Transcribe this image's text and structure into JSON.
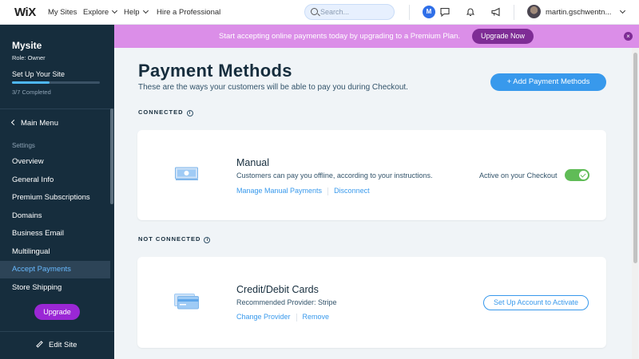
{
  "topbar": {
    "logo": "WiX",
    "nav": [
      "My Sites",
      "Explore",
      "Help",
      "Hire a Professional"
    ],
    "search_placeholder": "Search...",
    "avatar_letter": "M",
    "user_name": "martin.gschwentn..."
  },
  "sidebar": {
    "site_name": "Mysite",
    "role": "Role: Owner",
    "setup_title": "Set Up Your Site",
    "setup_progress": 0.43,
    "setup_completed": "3/7 Completed",
    "main_menu": "Main Menu",
    "settings_label": "Settings",
    "items": [
      {
        "label": "Overview",
        "active": false
      },
      {
        "label": "General Info",
        "active": false
      },
      {
        "label": "Premium Subscriptions",
        "active": false
      },
      {
        "label": "Domains",
        "active": false
      },
      {
        "label": "Business Email",
        "active": false
      },
      {
        "label": "Multilingual",
        "active": false
      },
      {
        "label": "Accept Payments",
        "active": true
      },
      {
        "label": "Store Shipping",
        "active": false
      }
    ],
    "upgrade_label": "Upgrade",
    "edit_site_label": "Edit Site"
  },
  "banner": {
    "text": "Start accepting online payments today by upgrading to a Premium Plan.",
    "button": "Upgrade Now",
    "close": "×"
  },
  "main": {
    "title": "Payment Methods",
    "subtitle": "These are the ways your customers will be able to pay you during Checkout.",
    "add_button": "+ Add Payment Methods",
    "connected_label": "CONNECTED",
    "not_connected_label": "NOT CONNECTED",
    "info_glyph": "i",
    "manual": {
      "title": "Manual",
      "description": "Customers can pay you offline, according to your instructions.",
      "link_manage": "Manage Manual Payments",
      "link_disconnect": "Disconnect",
      "active_label": "Active on your Checkout",
      "active": true
    },
    "cards": {
      "title": "Credit/Debit Cards",
      "provider": "Recommended Provider: Stripe",
      "link_change": "Change Provider",
      "link_remove": "Remove",
      "setup_button": "Set Up Account to Activate"
    }
  },
  "colors": {
    "sidebar_bg": "#162d3d",
    "accent_blue": "#3899ec",
    "banner_bg": "#db8ee8",
    "upgrade_purple": "#9a27d5",
    "toggle_green": "#60bc57"
  }
}
